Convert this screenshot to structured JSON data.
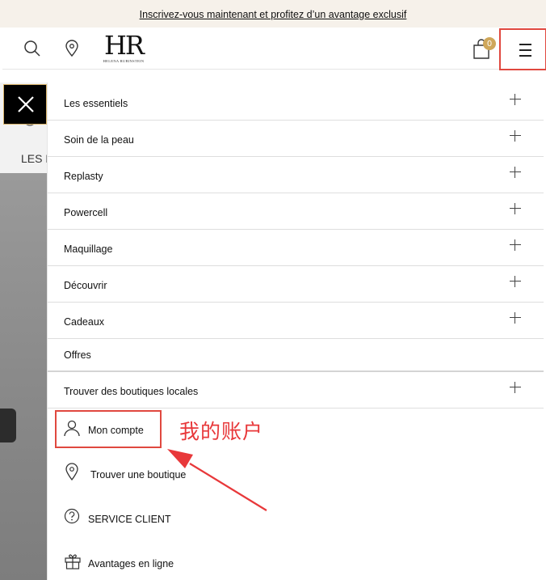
{
  "promo": {
    "text": "Inscrivez-vous maintenant et profitez d’un avantage exclusif"
  },
  "header": {
    "logo_text": "HR",
    "logo_sub": "HELENA RUBINSTEIN",
    "cart_count": "0"
  },
  "background": {
    "section_label": "LES B"
  },
  "menu": {
    "items": [
      {
        "label": "Les essentiels",
        "expandable": true
      },
      {
        "label": "Soin de la peau",
        "expandable": true
      },
      {
        "label": "Replasty",
        "expandable": true
      },
      {
        "label": "Powercell",
        "expandable": true
      },
      {
        "label": "Maquillage",
        "expandable": true
      },
      {
        "label": "Découvrir",
        "expandable": true
      },
      {
        "label": "Cadeaux",
        "expandable": true
      },
      {
        "label": "Offres",
        "expandable": false
      },
      {
        "label": "Trouver des boutiques locales",
        "expandable": true
      }
    ],
    "utility": [
      {
        "label": "Mon compte",
        "icon": "user-icon"
      },
      {
        "label": "Trouver une boutique",
        "icon": "map-pin-icon"
      },
      {
        "label": "SERVICE CLIENT",
        "icon": "question-circle-icon"
      },
      {
        "label": "Avantages en ligne",
        "icon": "gift-icon"
      }
    ]
  },
  "annotation": {
    "text": "我的账户",
    "color": "#e8383a"
  },
  "colors": {
    "highlight": "#e0483f",
    "badge": "#cfa75a",
    "promo_bg": "#f6f1ea"
  }
}
